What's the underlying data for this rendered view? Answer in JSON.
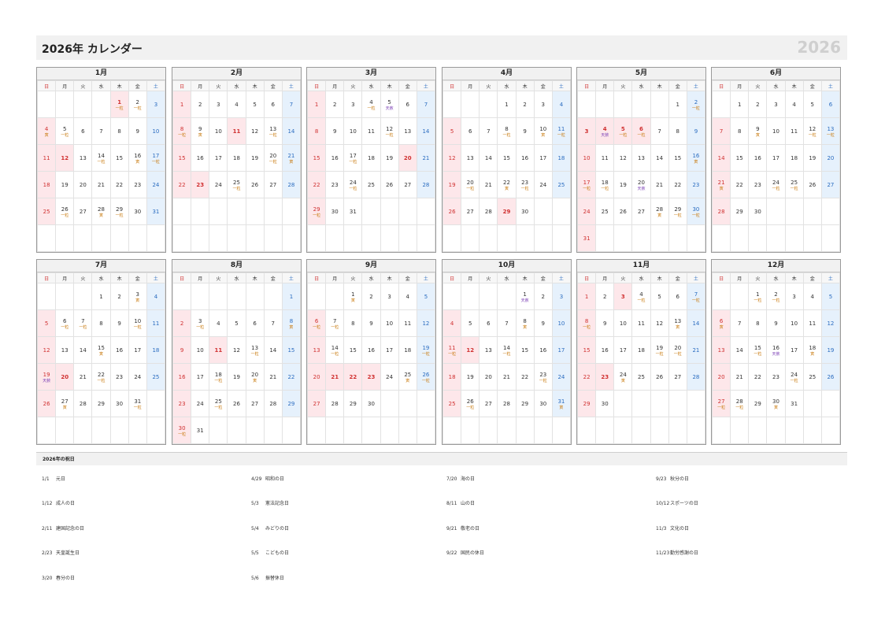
{
  "header": {
    "title": "2026年 カレンダー",
    "year": "2026"
  },
  "weekday_labels": [
    "日",
    "月",
    "火",
    "水",
    "木",
    "金",
    "土"
  ],
  "tag_labels": {
    "ikkai": "一粒",
    "tora": "寅",
    "tensha": "天赦"
  },
  "months": [
    {
      "name": "1月",
      "start": 4,
      "days": 31,
      "holidays": [
        1,
        12
      ],
      "marks": {
        "1": "ikkai",
        "2": "ikkai",
        "4": "tora",
        "5": "ikkai",
        "14": "ikkai",
        "16": "tora",
        "17": "ikkai",
        "26": "ikkai",
        "28": "tora",
        "29": "ikkai"
      }
    },
    {
      "name": "2月",
      "start": 0,
      "days": 28,
      "holidays": [
        11,
        23
      ],
      "marks": {
        "8": "ikkai",
        "9": "tora",
        "13": "ikkai",
        "20": "ikkai",
        "21": "tora",
        "25": "ikkai"
      }
    },
    {
      "name": "3月",
      "start": 0,
      "days": 31,
      "holidays": [
        20
      ],
      "marks": {
        "4": "ikkai",
        "5": "tensha",
        "12": "ikkai",
        "17": "ikkai",
        "24": "ikkai",
        "29": "ikkai"
      }
    },
    {
      "name": "4月",
      "start": 3,
      "days": 30,
      "holidays": [
        29
      ],
      "marks": {
        "8": "ikkai",
        "10": "tora",
        "11": "ikkai",
        "20": "ikkai",
        "22": "tora",
        "23": "ikkai"
      }
    },
    {
      "name": "5月",
      "start": 5,
      "days": 31,
      "holidays": [
        3,
        4,
        5,
        6
      ],
      "marks": {
        "2": "ikkai",
        "4": "tensha",
        "5": "ikkai",
        "6": "ikkai",
        "16": "tora",
        "17": "ikkai",
        "18": "ikkai",
        "20": "tensha",
        "28": "tora",
        "29": "ikkai",
        "30": "ikkai"
      }
    },
    {
      "name": "6月",
      "start": 1,
      "days": 30,
      "holidays": [],
      "marks": {
        "9": "tora",
        "12": "ikkai",
        "13": "ikkai",
        "21": "tora",
        "24": "ikkai",
        "25": "ikkai"
      }
    },
    {
      "name": "7月",
      "start": 3,
      "days": 31,
      "holidays": [
        20
      ],
      "marks": {
        "3": "tora",
        "6": "ikkai",
        "7": "ikkai",
        "10": "ikkai",
        "15": "tora",
        "19": "tensha",
        "22": "ikkai",
        "27": "tora",
        "31": "ikkai"
      }
    },
    {
      "name": "8月",
      "start": 6,
      "days": 31,
      "holidays": [
        11
      ],
      "marks": {
        "3": "ikkai",
        "8": "tora",
        "13": "ikkai",
        "18": "ikkai",
        "20": "tora",
        "25": "ikkai",
        "30": "ikkai"
      }
    },
    {
      "name": "9月",
      "start": 2,
      "days": 30,
      "holidays": [
        21,
        22,
        23
      ],
      "marks": {
        "1": "tora",
        "6": "ikkai",
        "7": "ikkai",
        "14": "ikkai",
        "19": "ikkai",
        "25": "tora",
        "26": "ikkai"
      }
    },
    {
      "name": "10月",
      "start": 4,
      "days": 31,
      "holidays": [
        12
      ],
      "marks": {
        "1": "tensha",
        "8": "tora",
        "11": "ikkai",
        "14": "ikkai",
        "23": "ikkai",
        "26": "ikkai",
        "31": "tora"
      }
    },
    {
      "name": "11月",
      "start": 0,
      "days": 30,
      "holidays": [
        3,
        23
      ],
      "marks": {
        "4": "ikkai",
        "7": "ikkai",
        "8": "ikkai",
        "13": "tora",
        "19": "ikkai",
        "20": "ikkai",
        "24": "tora"
      }
    },
    {
      "name": "12月",
      "start": 2,
      "days": 31,
      "holidays": [],
      "marks": {
        "1": "ikkai",
        "2": "ikkai",
        "6": "tora",
        "15": "ikkai",
        "16": "tensha",
        "18": "tora",
        "24": "ikkai",
        "27": "ikkai",
        "28": "ikkai",
        "30": "tora"
      }
    }
  ],
  "holiday_section_title": "2026年の祝日",
  "holiday_list": [
    {
      "date": "1/1",
      "name": "元日"
    },
    {
      "date": "1/12",
      "name": "成人の日"
    },
    {
      "date": "2/11",
      "name": "建国記念の日"
    },
    {
      "date": "2/23",
      "name": "天皇誕生日"
    },
    {
      "date": "3/20",
      "name": "春分の日"
    },
    {
      "date": "4/29",
      "name": "昭和の日"
    },
    {
      "date": "5/3",
      "name": "憲法記念日"
    },
    {
      "date": "5/4",
      "name": "みどりの日"
    },
    {
      "date": "5/5",
      "name": "こどもの日"
    },
    {
      "date": "5/6",
      "name": "振替休日"
    },
    {
      "date": "7/20",
      "name": "海の日"
    },
    {
      "date": "8/11",
      "name": "山の日"
    },
    {
      "date": "9/21",
      "name": "敬老の日"
    },
    {
      "date": "9/22",
      "name": "国民の休日"
    },
    {
      "date": "9/23",
      "name": "秋分の日"
    },
    {
      "date": "10/12",
      "name": "スポーツの日"
    },
    {
      "date": "11/3",
      "name": "文化の日"
    },
    {
      "date": "11/23",
      "name": "勤労感謝の日"
    }
  ]
}
